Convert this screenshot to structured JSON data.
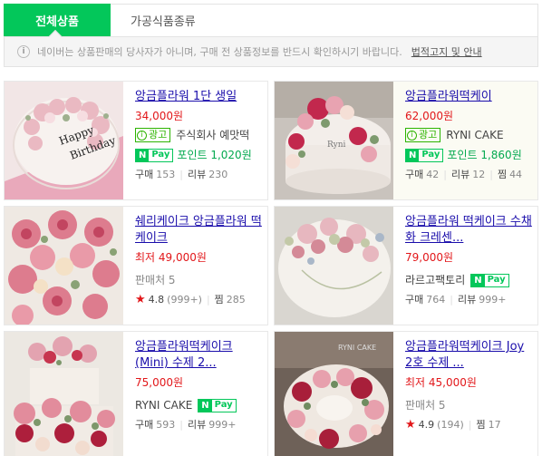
{
  "tabs": [
    {
      "label": "전체상품",
      "active": true
    },
    {
      "label": "가공식품종류",
      "active": false
    }
  ],
  "notice": {
    "text": "네이버는 상품판매의 당사자가 아니며, 구매 전 상품정보를 반드시 확인하시기 바랍니다.",
    "link_label": "법적고지 및 안내"
  },
  "products": [
    {
      "title": "앙금플라워 1단 생일",
      "price": "34,000원",
      "ad": "광고",
      "seller": "주식회사 예맛떡",
      "npay_point": "포인트 1,020원",
      "stats": {
        "buy_label": "구매",
        "buy": "153",
        "review_label": "리뷰",
        "review": "230"
      }
    },
    {
      "title": "앙금플라워떡케이",
      "price": "62,000원",
      "ad": "광고",
      "seller": "RYNI CAKE",
      "npay_point": "포인트 1,860원",
      "stats": {
        "buy_label": "구매",
        "buy": "42",
        "review_label": "리뷰",
        "review": "12",
        "zzim_label": "찜",
        "zzim": "44"
      }
    },
    {
      "title": "쉐리케이크 앙금플라워 떡케이크",
      "price": "최저 49,000원",
      "sellers": "판매처 5",
      "rating": "4.8",
      "rating_count": "(999+)",
      "zzim_label": "찜",
      "zzim": "285"
    },
    {
      "title": "앙금플라워 떡케이크 수채화 크레센...",
      "price": "79,000원",
      "seller": "라르고팩토리",
      "stats": {
        "buy_label": "구매",
        "buy": "764",
        "review_label": "리뷰",
        "review": "999+"
      }
    },
    {
      "title": "앙금플라워떡케이크 (Mini) 수제 2...",
      "price": "75,000원",
      "seller": "RYNI CAKE",
      "stats": {
        "buy_label": "구매",
        "buy": "593",
        "review_label": "리뷰",
        "review": "999+"
      }
    },
    {
      "title": "앙금플라워떡케이크 Joy 2호 수제 ...",
      "price": "최저 45,000원",
      "sellers": "판매처 5",
      "rating": "4.9",
      "rating_count": "(194)",
      "zzim_label": "찜",
      "zzim": "17"
    }
  ],
  "npay_label": {
    "n": "N",
    "pay": "Pay"
  },
  "icons": {
    "notice": "info-icon",
    "ad": "info-icon",
    "rating": "star-icon"
  },
  "colors": {
    "accent": "#03c75a",
    "price": "#e2171a",
    "link": "#1a0dab"
  }
}
